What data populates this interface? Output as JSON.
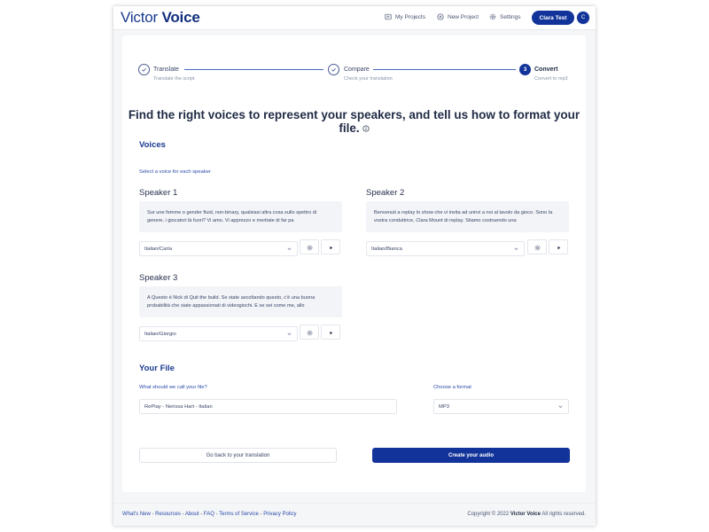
{
  "header": {
    "logo_light": "Victor",
    "logo_bold": "Voice",
    "nav": [
      {
        "label": "My Projects",
        "icon": "folder-icon"
      },
      {
        "label": "New Project",
        "icon": "plus-circle-icon"
      },
      {
        "label": "Settings",
        "icon": "gear-icon"
      }
    ],
    "user_button": "Clara Test",
    "avatar_initial": "C"
  },
  "stepper": {
    "steps": [
      {
        "title": "Translate",
        "subtitle": "Translate the script",
        "state": "done"
      },
      {
        "title": "Compare",
        "subtitle": "Check your translation",
        "state": "done"
      },
      {
        "number": "3",
        "title": "Convert",
        "subtitle": "Convert to mp3",
        "state": "active"
      }
    ]
  },
  "headline": "Find the right voices to represent your speakers, and tell us how to format your file.",
  "voices": {
    "title": "Voices",
    "helper": "Select a voice for each speaker",
    "speakers": [
      {
        "name": "Speaker 1",
        "text": "Sur une femme o gender fluid, non-binary, qualsiasi altra cosa sullo spettro di genere, i giocatori là fuori? Vi amo. Vi apprezzo e meritate di far pa",
        "voice": "Italian/Carla"
      },
      {
        "name": "Speaker 2",
        "text": "Benvenuti a replay lo show che vi invita ad unirvi a noi al tavolo da gioco. Sono la vostra conduttrice, Clara Mount di replay. Stiamo costruendo una",
        "voice": "Italian/Bianca"
      },
      {
        "name": "Speaker 3",
        "text": "A Questo è Nick di Quit the build. Se state ascoltando questo, c'è una buona probabilità che siate appassionati di videogiochi. E se sei come me, allo",
        "voice": "Italian/Giorgio"
      }
    ]
  },
  "file": {
    "title": "Your File",
    "name_label": "What should we call your file?",
    "name_value": "RePlay - Nerissa Hart - Italian",
    "format_label": "Choose a format",
    "format_value": "MP3"
  },
  "actions": {
    "back": "Go back to your translation",
    "create": "Create your audio"
  },
  "footer": {
    "links": [
      "What's New",
      "Resources",
      "About",
      "FAQ",
      "Terms of Service",
      "Privacy Policy"
    ],
    "separator": " - ",
    "copyright_prefix": "Copyright © 2022",
    "copyright_brand": "Victor Voice",
    "copyright_suffix": "All rights reserved."
  },
  "colors": {
    "primary": "#12349a",
    "brand_text": "#1a3a8f",
    "card_bg": "#ffffff",
    "page_bg": "#f5f6f8"
  }
}
